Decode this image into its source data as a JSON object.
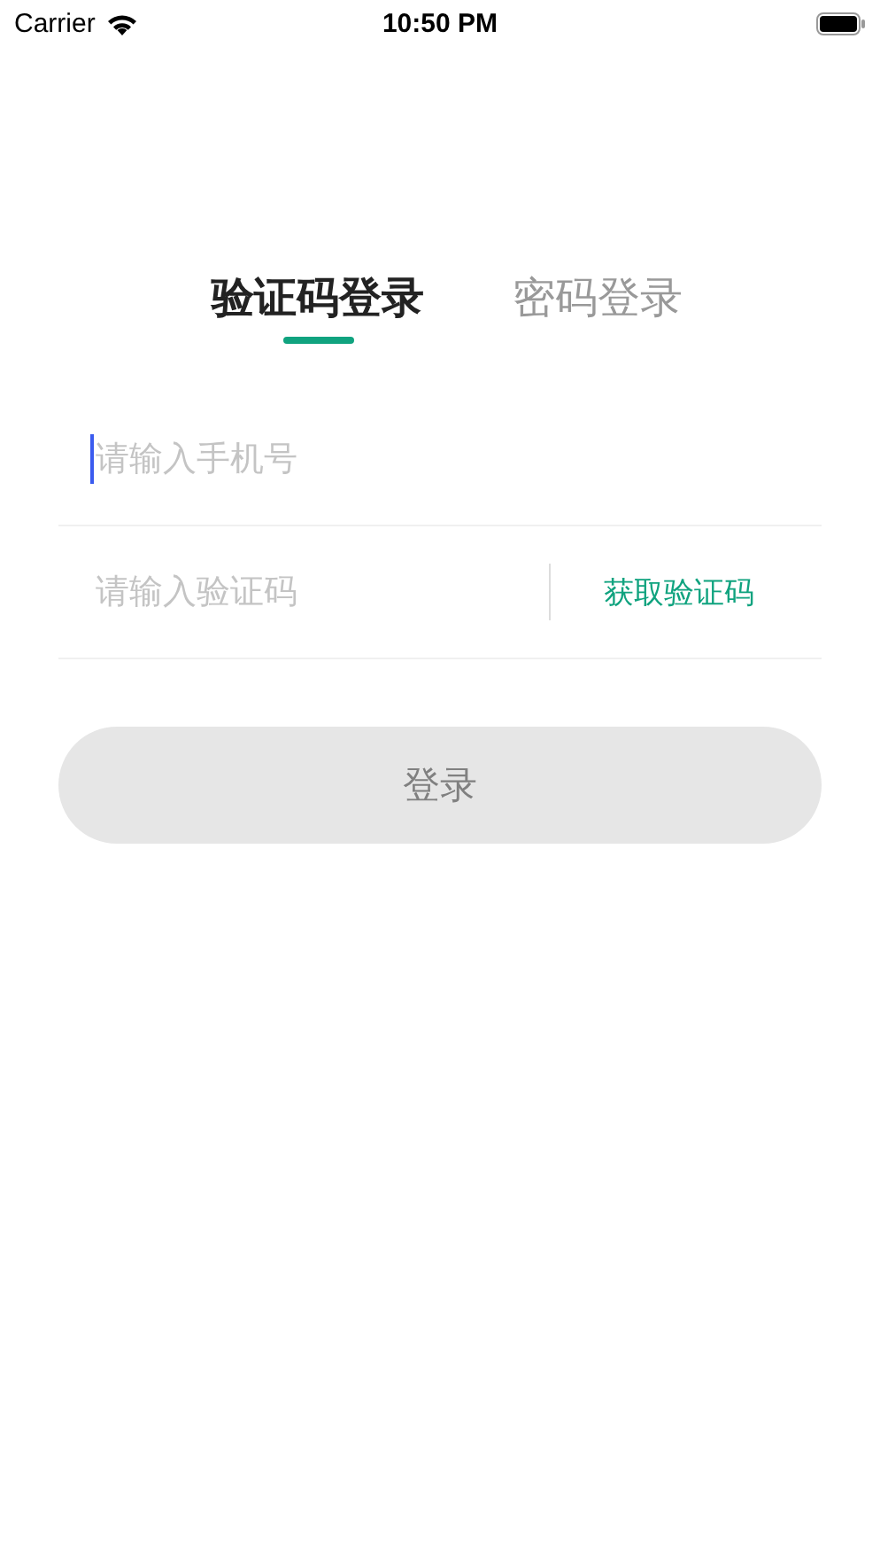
{
  "status_bar": {
    "carrier": "Carrier",
    "time": "10:50 PM"
  },
  "tabs": [
    {
      "label": "验证码登录",
      "selected": true
    },
    {
      "label": "密码登录",
      "selected": false
    }
  ],
  "fields": [
    {
      "kind": "phone",
      "placeholder": "请输入手机号",
      "focused": true
    },
    {
      "kind": "code",
      "placeholder": "请输入验证码",
      "focused": false,
      "action": "获取验证码"
    }
  ],
  "login_button": {
    "label": "登录",
    "disabled": true
  }
}
